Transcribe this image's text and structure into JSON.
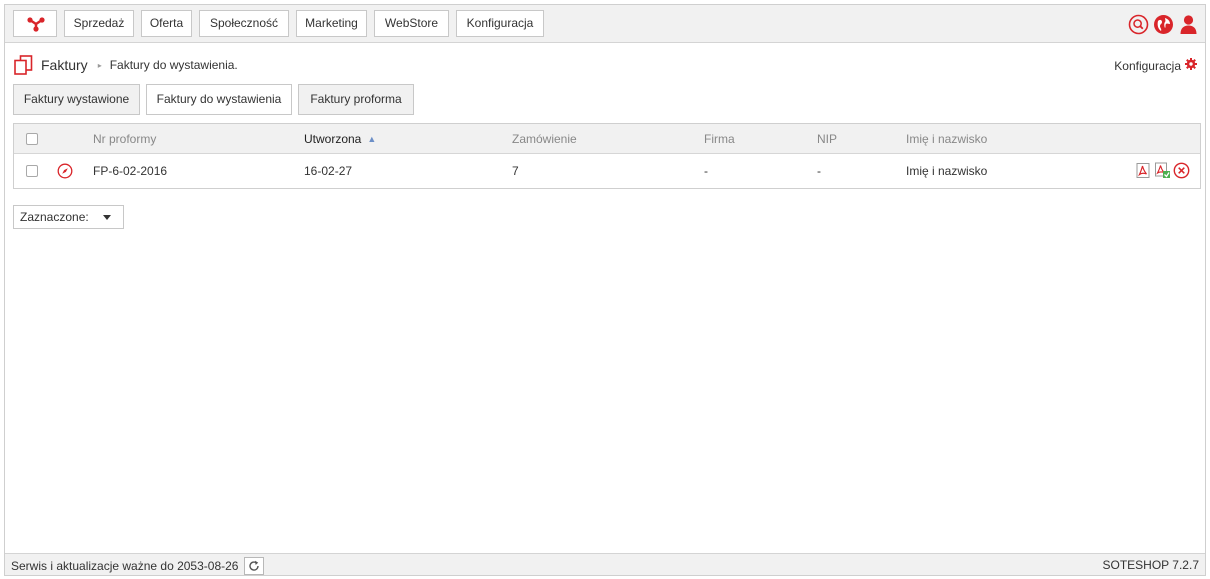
{
  "nav": {
    "logo_icon": "soteshop-logo-icon",
    "items": [
      {
        "label": "Sprzedaż"
      },
      {
        "label": "Oferta"
      },
      {
        "label": "Społeczność"
      },
      {
        "label": "Marketing"
      },
      {
        "label": "WebStore"
      },
      {
        "label": "Konfiguracja"
      }
    ],
    "right_icons": [
      "search-icon",
      "globe-icon",
      "user-icon"
    ],
    "accent_color": "#d9252a"
  },
  "breadcrumb": {
    "icon": "documents-icon",
    "title": "Faktury",
    "separator": "▸",
    "current": "Faktury do wystawienia."
  },
  "config_link": {
    "label": "Konfiguracja",
    "icon": "gear-icon"
  },
  "tabs": [
    {
      "label": "Faktury wystawione",
      "active": false
    },
    {
      "label": "Faktury do wystawienia",
      "active": true
    },
    {
      "label": "Faktury proforma",
      "active": false
    }
  ],
  "table": {
    "columns": [
      "Nr proformy",
      "Utworzona",
      "Zamówienie",
      "Firma",
      "NIP",
      "Imię i nazwisko"
    ],
    "sorted_column": "Utworzona",
    "sort_direction": "ascending",
    "sort_arrow": "▲",
    "rows": [
      {
        "edit_icon": "edit-compass-icon",
        "nr_proformy": "FP-6-02-2016",
        "utworzona": "16-02-27",
        "zamowienie": "7",
        "firma": "-",
        "nip": "-",
        "imie_nazwisko": "Imię i nazwisko",
        "actions": [
          "pdf-icon",
          "pdf-export-icon",
          "delete-icon"
        ]
      }
    ]
  },
  "selection": {
    "label": "Zaznaczone:"
  },
  "footer": {
    "service_text": "Serwis i aktualizacje ważne do 2053-08-26",
    "refresh_icon": "refresh-icon",
    "version": "SOTESHOP 7.2.7"
  }
}
